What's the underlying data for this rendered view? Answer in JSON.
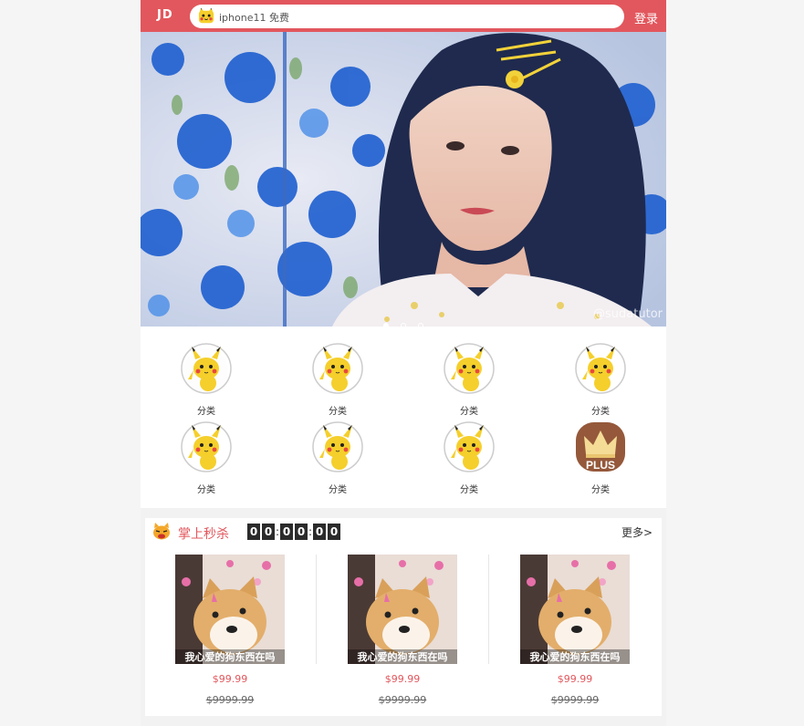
{
  "header": {
    "logo": "JD",
    "search_text": "iphone11 免费",
    "search_icon": "pikachu-icon",
    "login_label": "登录",
    "bg_color": "#e2575d"
  },
  "banner": {
    "watermark": "@sudatutor",
    "slide_count": 3,
    "active_slide": 0
  },
  "nav": {
    "items": [
      {
        "label": "分类",
        "icon": "pikachu-icon"
      },
      {
        "label": "分类",
        "icon": "pikachu-icon"
      },
      {
        "label": "分类",
        "icon": "pikachu-icon"
      },
      {
        "label": "分类",
        "icon": "pikachu-icon"
      },
      {
        "label": "分类",
        "icon": "pikachu-icon"
      },
      {
        "label": "分类",
        "icon": "pikachu-icon"
      },
      {
        "label": "分类",
        "icon": "pikachu-icon"
      },
      {
        "label": "分类",
        "icon": "plus-crown-icon"
      }
    ],
    "plus_text": "PLUS"
  },
  "seckill": {
    "title": "掌上秒杀",
    "timer": [
      "0",
      "0",
      "0",
      "0",
      "0",
      "0"
    ],
    "timer_sep": ":",
    "more_label": "更多>",
    "products": [
      {
        "caption": "我心爱的狗东西在吗",
        "price": "$99.99",
        "old_price": "$9999.99"
      },
      {
        "caption": "我心爱的狗东西在吗",
        "price": "$99.99",
        "old_price": "$9999.99"
      },
      {
        "caption": "我心爱的狗东西在吗",
        "price": "$99.99",
        "old_price": "$9999.99"
      }
    ]
  }
}
